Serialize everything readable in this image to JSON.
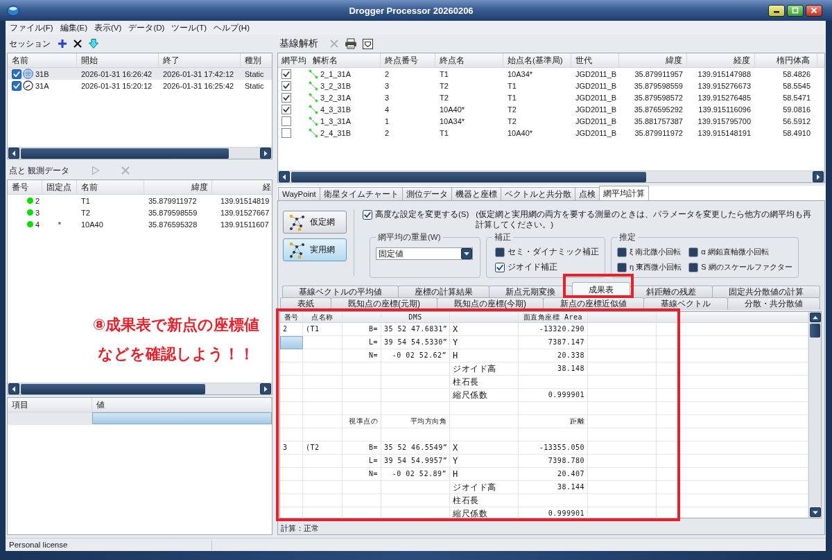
{
  "window": {
    "title": "Drogger Processor 20260206"
  },
  "menu": [
    "ファイル(F)",
    "編集(E)",
    "表示(V)",
    "データ(D)",
    "ツール(T)",
    "ヘルプ(H)"
  ],
  "sessions": {
    "title": "セッション",
    "columns": [
      "名前",
      "開始",
      "終了",
      "種別"
    ],
    "rows": [
      {
        "selected": true,
        "checked": true,
        "kind": "globe",
        "cells": [
          "31B",
          "2026-01-31 16:26:42",
          "2026-01-31 17:42:12",
          "Static"
        ]
      },
      {
        "selected": false,
        "checked": true,
        "kind": "dial",
        "cells": [
          "31A",
          "2026-01-31 15:20:12",
          "2026-01-31 16:25:42",
          "Static"
        ]
      }
    ]
  },
  "points": {
    "title": "点と 観測データ",
    "columns": [
      "番号",
      "固定点",
      "名前",
      "緯度",
      "経"
    ],
    "rows": [
      {
        "color": "#00e000",
        "cells": [
          "2",
          null,
          "T1",
          "35.879911972",
          "139.91514819"
        ]
      },
      {
        "color": "#00e000",
        "cells": [
          "3",
          null,
          "T2",
          "35.879598559",
          "139.91527667"
        ]
      },
      {
        "color": "#00e000",
        "cells": [
          "4",
          "*",
          "10A40",
          "35.876595328",
          "139.91511607"
        ]
      }
    ]
  },
  "annotation": {
    "lines": [
      "⑧成果表で新点の座標値",
      "などを確認しよう！！"
    ]
  },
  "properties": {
    "columns": [
      "項目",
      "値"
    ],
    "rows": [
      {
        "selected": true
      }
    ]
  },
  "baseline": {
    "title": "基線解析",
    "columns": [
      "網平均",
      "解析名",
      "終点番号",
      "終点名",
      "始点名(基準局)",
      "世代",
      "緯度",
      "経度",
      "楕円体高"
    ],
    "rows": [
      {
        "checked": true,
        "cells": [
          null,
          "2_1_31A",
          "2",
          "T1",
          "10A34*",
          "JGD2011_B",
          "35.879911957",
          "139.915147988",
          "58.4826"
        ]
      },
      {
        "checked": true,
        "cells": [
          null,
          "3_2_31B",
          "3",
          "T2",
          "T1",
          "JGD2011_B",
          "35.879598559",
          "139.915276673",
          "58.5545"
        ]
      },
      {
        "checked": true,
        "cells": [
          null,
          "3_2_31A",
          "3",
          "T2",
          "T1",
          "JGD2011_B",
          "35.879598572",
          "139.915276485",
          "58.5471"
        ]
      },
      {
        "checked": true,
        "cells": [
          null,
          "4_3_31B",
          "4",
          "10A40*",
          "T2",
          "JGD2011_B",
          "35.876595292",
          "139.915116096",
          "59.0816"
        ]
      },
      {
        "checked": false,
        "cells": [
          null,
          "1_3_31A",
          "1",
          "10A34*",
          "T2",
          "JGD2011_B",
          "35.881757387",
          "139.915795700",
          "56.5912"
        ]
      },
      {
        "checked": false,
        "cells": [
          null,
          "2_4_31B",
          "2",
          "T1",
          "10A40*",
          "JGD2011_B",
          "35.879911972",
          "139.915148191",
          "58.4910"
        ]
      }
    ]
  },
  "tabs": [
    {
      "label": "WayPoint",
      "selected": false
    },
    {
      "label": "衛星タイムチャート",
      "selected": false
    },
    {
      "label": "測位データ",
      "selected": false
    },
    {
      "label": "機器と座標",
      "selected": false
    },
    {
      "label": "ベクトルと共分散",
      "selected": false
    },
    {
      "label": "点検",
      "selected": false
    },
    {
      "label": "網平均計算",
      "selected": true
    }
  ],
  "network": {
    "buttons": [
      {
        "label": "仮定網",
        "selected": false
      },
      {
        "label": "実用網",
        "selected": true
      }
    ],
    "advanced": {
      "label": "高度な設定を変更する(S)",
      "checked": true,
      "note": "(仮定網と実用網の両方を要する測量のときは、パラメータを変更したら他方の網平均も再計算してください。)"
    },
    "weight": {
      "title": "網平均の重量(W)",
      "value": "固定値"
    },
    "correction": {
      "title": "補正",
      "options": [
        {
          "label": "セミ・ダイナミック補正",
          "checked": false
        },
        {
          "label": "ジオイド補正",
          "checked": true
        }
      ]
    },
    "estimation": {
      "title": "推定",
      "options": [
        {
          "label": "ξ 南北微小回転",
          "checked": false
        },
        {
          "label": "α 網鉛直軸微小回転",
          "checked": false
        },
        {
          "label": "η 東西微小回転",
          "checked": false
        },
        {
          "label": "S 網のスケールファクター",
          "checked": false
        }
      ]
    },
    "result_tabs": [
      [
        {
          "label": "基線ベクトルの平均値",
          "selected": false
        },
        {
          "label": "座標の計算結果",
          "selected": false
        },
        {
          "label": "新点元期変換",
          "selected": false
        },
        {
          "label": "成果表",
          "selected": true
        },
        {
          "label": "斜距離の残差",
          "selected": false
        },
        {
          "label": "固定共分散値の計算",
          "selected": false
        }
      ],
      [
        {
          "label": "表紙",
          "selected": false
        },
        {
          "label": "既知点の座標(元期)",
          "selected": false
        },
        {
          "label": "既知点の座標(今期)",
          "selected": false
        },
        {
          "label": "新点の座標近似値",
          "selected": false
        },
        {
          "label": "基線ベクトル",
          "selected": false
        },
        {
          "label": "分散・共分散値",
          "selected": false
        }
      ]
    ],
    "result_table": {
      "columns": [
        "番号",
        "点名称",
        null,
        "DMS",
        null,
        "面直角座標 Area",
        null,
        null
      ],
      "rows": [
        {
          "selected": false,
          "cells": [
            "2",
            "(T1",
            "B=",
            "35 52 47.6831”",
            "X",
            "-13320.290"
          ]
        },
        {
          "selected": true,
          "cells": [
            null,
            null,
            "L=",
            "39 54 54.5330”",
            "Y",
            "7387.147"
          ]
        },
        {
          "selected": false,
          "cells": [
            null,
            null,
            "N=",
            "-0 02 52.62”",
            "H",
            "20.338"
          ]
        },
        {
          "selected": false,
          "cells": [
            null,
            null,
            null,
            null,
            "ジオイド高",
            "38.148"
          ]
        },
        {
          "selected": false,
          "cells": [
            null,
            null,
            null,
            null,
            "柱石長",
            null
          ]
        },
        {
          "selected": false,
          "cells": [
            null,
            null,
            null,
            null,
            "縮尺係数",
            "0.999901"
          ]
        },
        {
          "selected": false,
          "cells": [
            null,
            null,
            null,
            null,
            null,
            null
          ]
        },
        {
          "selected": false,
          "cells": [
            null,
            null,
            "視準点の",
            "平均方向角",
            null,
            "距離"
          ]
        },
        {
          "selected": false,
          "cells": [
            null,
            null,
            null,
            null,
            null,
            null
          ]
        },
        {
          "selected": false,
          "cells": [
            "3",
            "(T2",
            "B=",
            "35 52 46.5549”",
            "X",
            "-13355.050"
          ]
        },
        {
          "selected": false,
          "cells": [
            null,
            null,
            "L=",
            "39 54 54.9957”",
            "Y",
            "7398.780"
          ]
        },
        {
          "selected": false,
          "cells": [
            null,
            null,
            "N=",
            "-0 02 52.89”",
            "H",
            "20.407"
          ]
        },
        {
          "selected": false,
          "cells": [
            null,
            null,
            null,
            null,
            "ジオイド高",
            "38.144"
          ]
        },
        {
          "selected": false,
          "cells": [
            null,
            null,
            null,
            null,
            "柱石長",
            null
          ]
        },
        {
          "selected": false,
          "cells": [
            null,
            null,
            null,
            null,
            "縮尺係数",
            "0.999901"
          ]
        }
      ]
    },
    "status": "計算：正常"
  },
  "status_bar": "Personal license"
}
